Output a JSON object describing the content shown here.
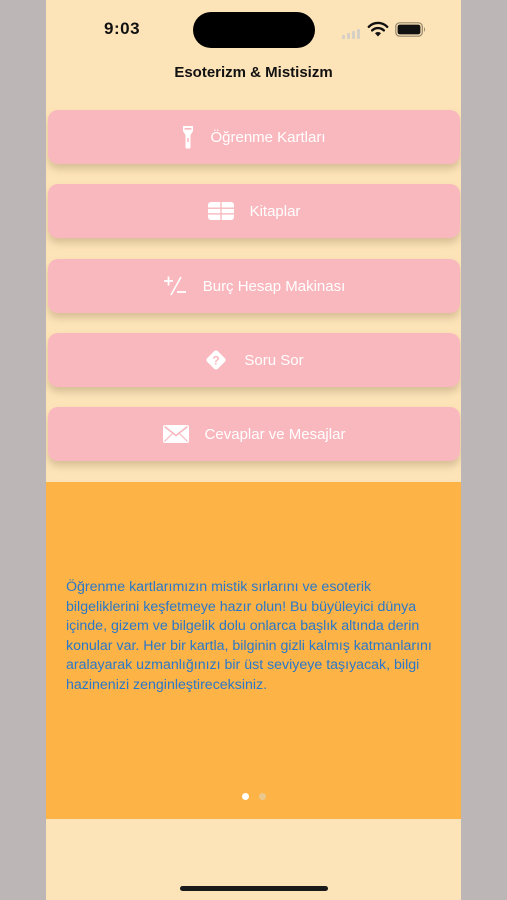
{
  "status_bar": {
    "time": "9:03"
  },
  "header": {
    "title": "Esoterizm & Mistisizm"
  },
  "menu": {
    "items": [
      {
        "label": "Öğrenme Kartları",
        "icon": "flashlight-icon"
      },
      {
        "label": "Kitaplar",
        "icon": "books-grid-icon"
      },
      {
        "label": "Burç Hesap Makinası",
        "icon": "plus-minus-icon"
      },
      {
        "label": "Soru Sor",
        "icon": "question-diamond-icon"
      },
      {
        "label": "Cevaplar ve Mesajlar",
        "icon": "envelope-icon"
      }
    ]
  },
  "info_panel": {
    "text": "Öğrenme kartlarımızın mistik sırlarını ve esoterik bilgeliklerini keşfetmeye hazır olun! Bu büyüleyici dünya içinde, gizem ve bilgelik dolu onlarca başlık altında derin konular var. Her bir kartla, bilginin gizli kalmış katmanlarını aralayarak uzmanlığınızı bir üst seviyeye taşıyacak, bilgi hazinenizi zenginleştireceksiniz.",
    "page_count": 2,
    "current_page": 1
  },
  "colors": {
    "background": "#fde4b8",
    "button": "#f9b8be",
    "panel": "#feb346",
    "info_text": "#2a78c9"
  }
}
